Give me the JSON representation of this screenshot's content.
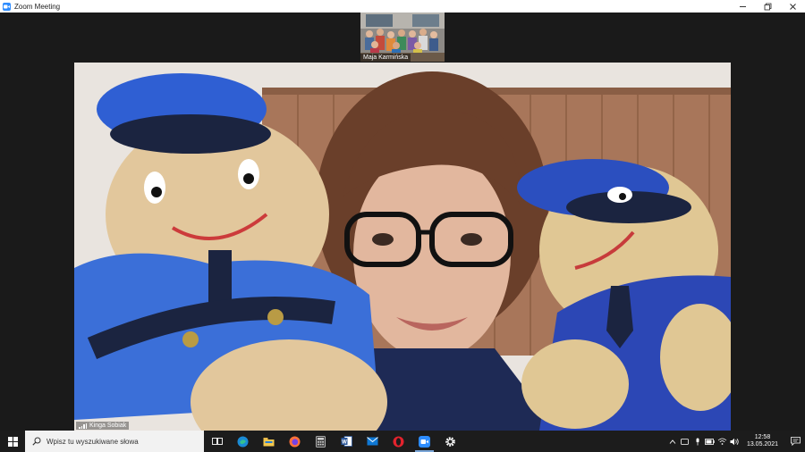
{
  "window": {
    "title": "Zoom Meeting",
    "controls": [
      "minimize",
      "maximize",
      "close"
    ]
  },
  "meeting": {
    "thumbnail_participant": "Maja Karmińska",
    "main_speaker": "Kinga Sobiak"
  },
  "taskbar": {
    "search_placeholder": "Wpisz tu wyszukiwane słowa",
    "pinned_apps": [
      "task-view",
      "edge",
      "file-explorer",
      "firefox",
      "calculator",
      "word",
      "mail",
      "opera",
      "zoom",
      "settings"
    ],
    "clock_time": "12:58",
    "clock_date": "13.05.2021"
  },
  "colors": {
    "titlebar": "#ffffff",
    "meeting_bg": "#1a1a1a",
    "taskbar": "#1c1c1c",
    "zoom_blue": "#2d8cff",
    "uniform_blue": "#3b6fd8"
  }
}
